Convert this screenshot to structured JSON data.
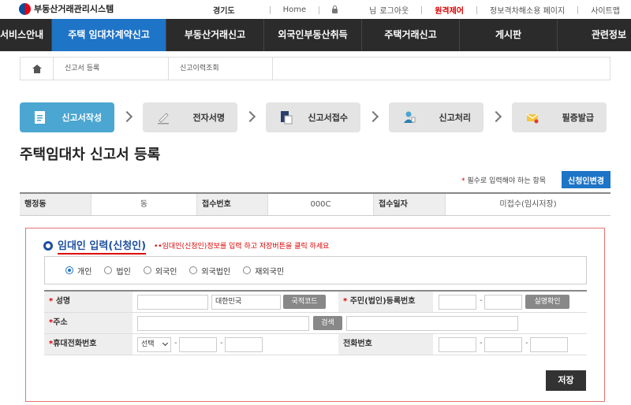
{
  "header": {
    "logo_text": "부동산거래관리시스템",
    "region": "경기도",
    "links": {
      "home": "Home",
      "user_prefix": "님",
      "logout": "로그아웃",
      "remote": "원격제어",
      "privacy": "정보격차해소용 페이지",
      "sitemap": "사이트맵"
    }
  },
  "nav": {
    "items": [
      {
        "label": "서비스안내"
      },
      {
        "label": "주택 임대차계약신고"
      },
      {
        "label": "부동산거래신고"
      },
      {
        "label": "외국인부동산취득"
      },
      {
        "label": "주택거래신고"
      },
      {
        "label": "게시판"
      },
      {
        "label": "관련정보"
      }
    ]
  },
  "breadcrumb": {
    "items": [
      "신고서 등록",
      "신고이력조회"
    ]
  },
  "steps": [
    {
      "label": "신고서작성",
      "icon": "document-icon",
      "active": true
    },
    {
      "label": "전자서명",
      "icon": "pen-icon"
    },
    {
      "label": "신고서접수",
      "icon": "file-icon"
    },
    {
      "label": "신고처리",
      "icon": "person-icon"
    },
    {
      "label": "필증발급",
      "icon": "envelope-icon"
    }
  ],
  "page": {
    "title": "주택임대차 신고서 등록",
    "required_note": "필수로 입력해야 하는 항목",
    "change_button": "신청인변경"
  },
  "info": {
    "admin_dong_label": "행정동",
    "admin_dong_value": "동",
    "receipt_no_label": "접수번호",
    "receipt_no_value": "000C",
    "receipt_date_label": "접수일자",
    "receipt_date_value": "미접수(임시저장)"
  },
  "form": {
    "section_title": "임대인 입력(신청인)",
    "section_note": "••임대인(신청인)정보를 입력 하고 저장버튼을 클릭 하세요",
    "types": [
      "개인",
      "법인",
      "외국인",
      "외국법인",
      "재외국민"
    ],
    "selected_type": "개인",
    "name_label": "성명",
    "name_value": "",
    "nationality_value": "대한민국",
    "nationality_button": "국적코드",
    "regno_label": "주민(법인)등록번호",
    "verify_button": "실명확인",
    "address_label": "주소",
    "search_button": "검색",
    "mobile_label": "휴대전화번호",
    "mobile_select": "선택",
    "phone_label": "전화번호",
    "dash": "-",
    "save_button": "저장"
  },
  "colors": {
    "nav_bg": "#2b2b2b",
    "nav_active": "#1e74c6",
    "step_active": "#4ba6d1",
    "accent_red": "#dd0000",
    "section_blue": "#1e4fa0"
  }
}
